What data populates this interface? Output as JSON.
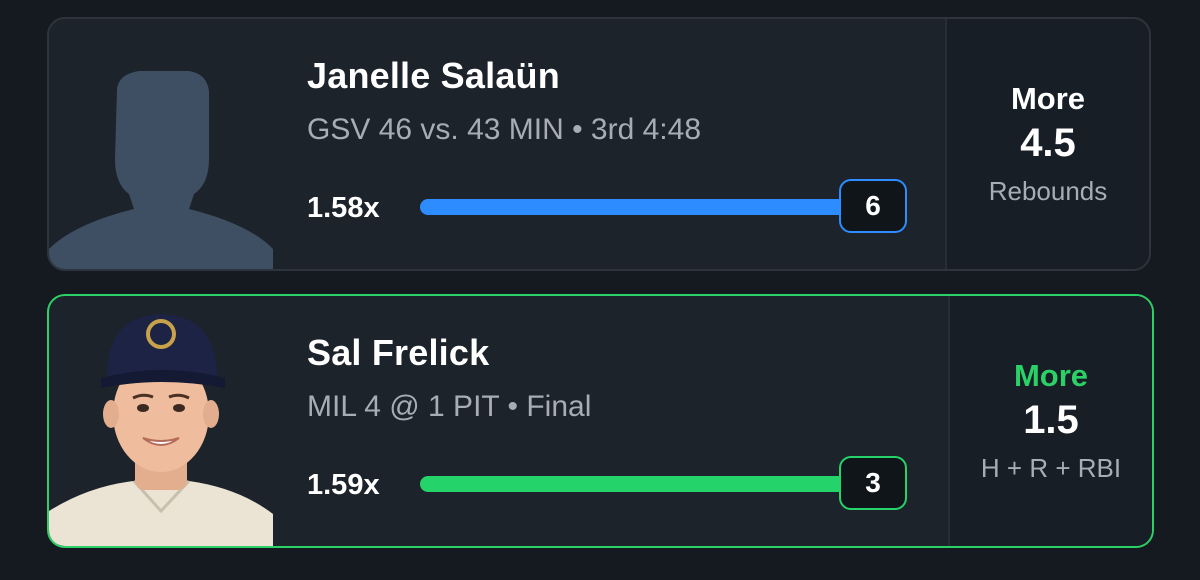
{
  "picks": [
    {
      "player": "Janelle Salaün",
      "game_info": "GSV 46 vs. 43 MIN • 3rd 4:48",
      "multiplier": "1.58x",
      "current_stat": "6",
      "progress": 1.0,
      "direction": "More",
      "line": "4.5",
      "stat_type": "Rebounds",
      "accent": "#2d8cff",
      "direction_color": "#ffffff",
      "avatar": "player-silhouette-icon"
    },
    {
      "player": "Sal Frelick",
      "game_info": "MIL 4 @ 1 PIT • Final",
      "multiplier": "1.59x",
      "current_stat": "3",
      "progress": 1.0,
      "direction": "More",
      "line": "1.5",
      "stat_type": "H + R + RBI",
      "accent": "#24d36a",
      "direction_color": "#2bd066",
      "avatar": "player-headshot-icon"
    }
  ]
}
